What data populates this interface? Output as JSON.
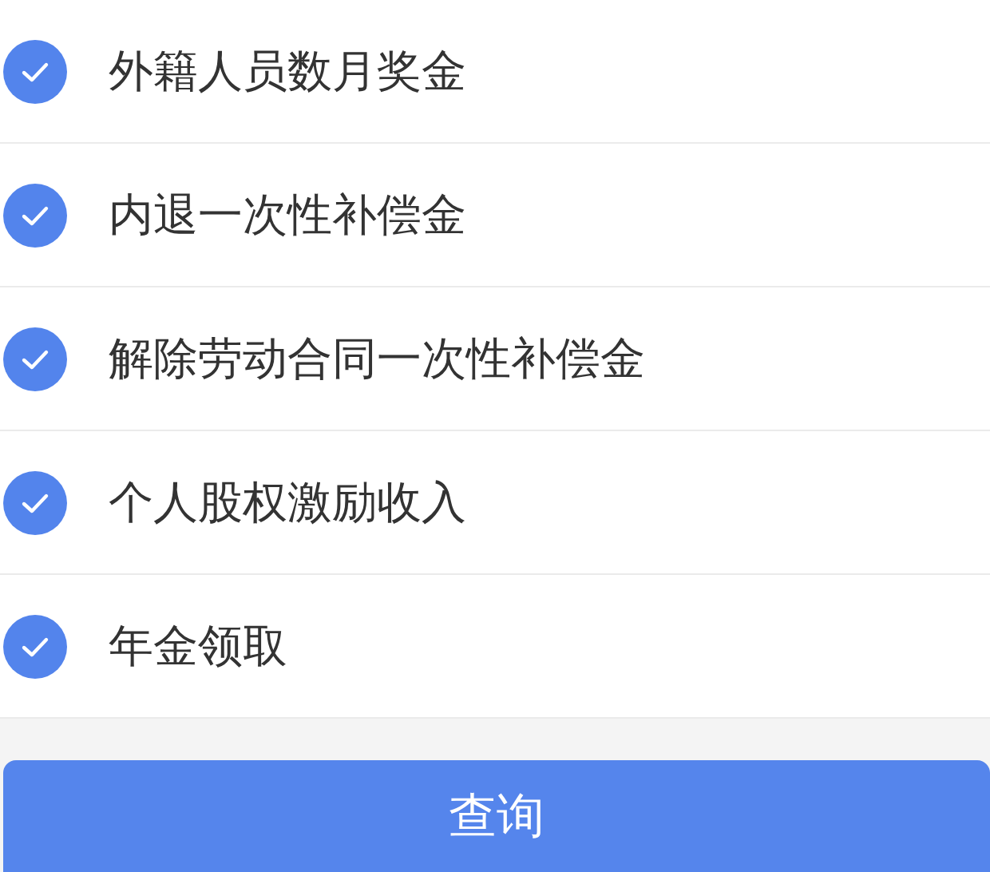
{
  "options": [
    {
      "label": "外籍人员数月奖金",
      "checked": true
    },
    {
      "label": "内退一次性补偿金",
      "checked": true
    },
    {
      "label": "解除劳动合同一次性补偿金",
      "checked": true
    },
    {
      "label": "个人股权激励收入",
      "checked": true
    },
    {
      "label": "年金领取",
      "checked": true
    }
  ],
  "button": {
    "label": "查询"
  }
}
